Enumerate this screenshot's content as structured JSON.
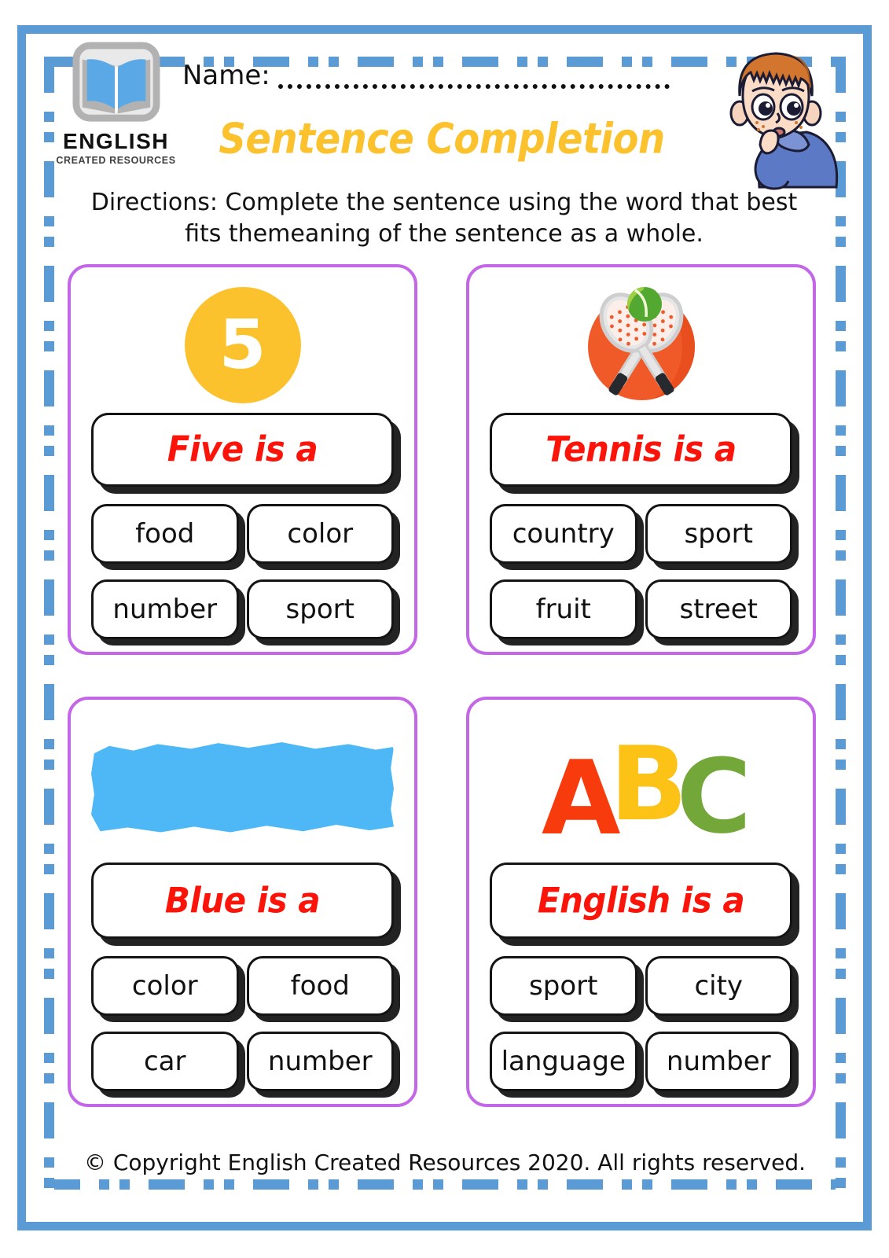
{
  "header": {
    "logo": {
      "icon": "open-book-icon",
      "title": "ENGLISH",
      "subtitle": "CREATED RESOURCES"
    },
    "name_label": "Name:",
    "name_value": "",
    "name_placeholder": "",
    "worksheet_title": "Sentence Completion",
    "directions": "Directions: Complete the sentence using the word that best fits themeaning of the sentence as a whole.",
    "mascot": "thinking-boy-illustration"
  },
  "colors": {
    "frame_blue": "#5b9bd5",
    "card_border_purple": "#c367e8",
    "title_yellow": "#fcc22e",
    "prompt_red": "#fb1409",
    "swatch_blue": "#4db8f5",
    "tennis_orange": "#f05a28",
    "abc_a": "#f83b0c",
    "abc_b": "#fcc216",
    "abc_c": "#74a73a"
  },
  "cards": [
    {
      "visual": "number-five-circle",
      "visual_value": "5",
      "prompt": "Five is a",
      "options": [
        "food",
        "color",
        "number",
        "sport"
      ]
    },
    {
      "visual": "tennis-rackets-icon",
      "visual_value": "",
      "prompt": "Tennis is a",
      "options": [
        "country",
        "sport",
        "fruit",
        "street"
      ]
    },
    {
      "visual": "blue-paint-swatch",
      "visual_value": "",
      "prompt": "Blue is a",
      "options": [
        "color",
        "food",
        "car",
        "number"
      ]
    },
    {
      "visual": "abc-letters",
      "visual_value": "ABC",
      "abc": {
        "a": "A",
        "b": "B",
        "c": "C"
      },
      "prompt": "English is a",
      "options": [
        "sport",
        "city",
        "language",
        "number"
      ]
    }
  ],
  "footer": {
    "copyright": "© Copyright English Created Resources 2020. All rights reserved."
  }
}
